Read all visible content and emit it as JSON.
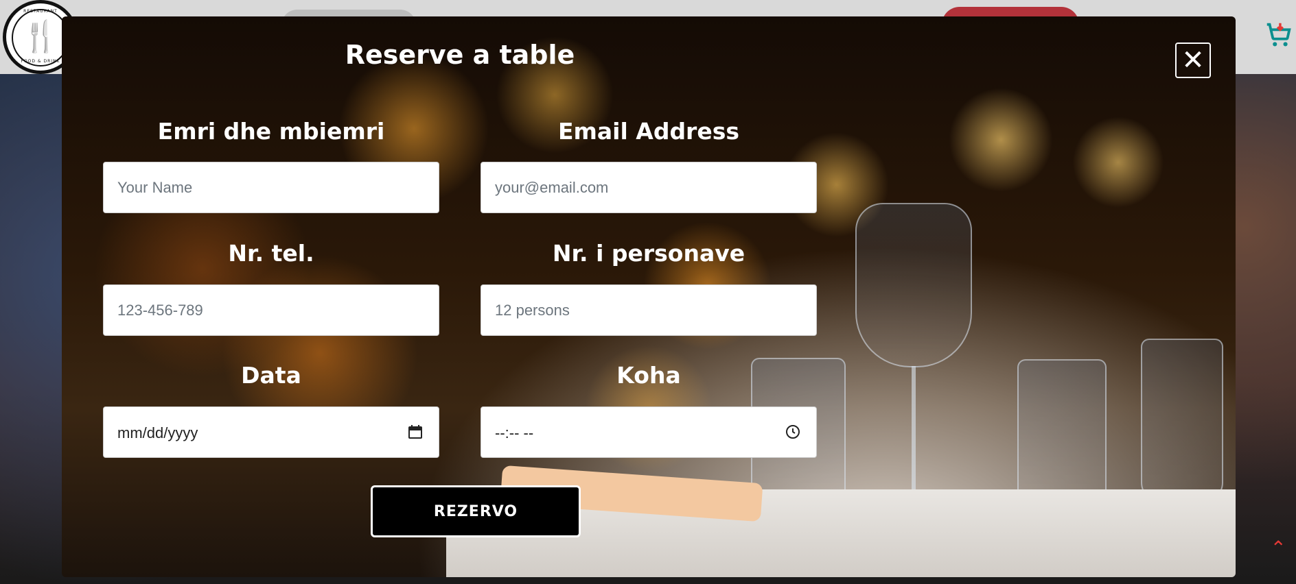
{
  "logo": {
    "top_text": "RESTAURANT",
    "bottom_text": "FOOD & DRINK"
  },
  "modal": {
    "title": "Reserve a table",
    "close_label": "✕",
    "fields": {
      "name": {
        "label": "Emri dhe mbiemri",
        "placeholder": "Your Name",
        "value": ""
      },
      "email": {
        "label": "Email Address",
        "placeholder": "your@email.com",
        "value": ""
      },
      "phone": {
        "label": "Nr. tel.",
        "placeholder": "123-456-789",
        "value": ""
      },
      "persons": {
        "label": "Nr. i personave",
        "placeholder": "12 persons",
        "value": ""
      },
      "date": {
        "label": "Data",
        "display": "mm/dd/yyyy"
      },
      "time": {
        "label": "Koha",
        "display": "--:-- --"
      }
    },
    "submit_label": "REZERVO"
  },
  "icons": {
    "cart": "cart-icon",
    "close": "close-icon",
    "calendar": "calendar-icon",
    "clock": "clock-icon",
    "scroll_top": "chevron-up-icon"
  },
  "colors": {
    "accent_red": "#b3323a",
    "cart_teal": "#0c8f8f",
    "scroll_top_red": "#e53935"
  }
}
